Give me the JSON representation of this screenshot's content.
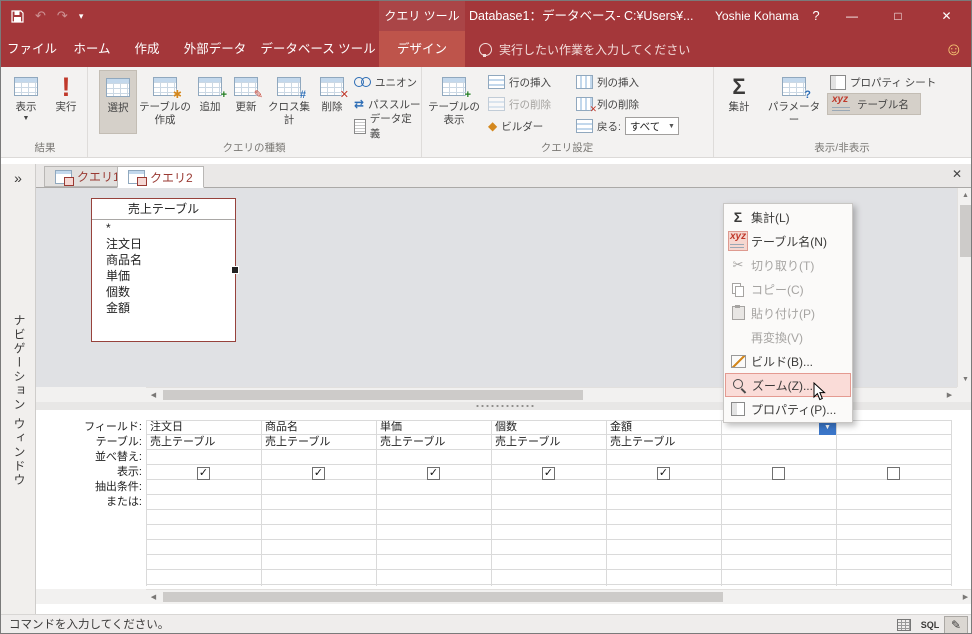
{
  "window": {
    "contextual_tool": "クエリ ツール",
    "title": "Database1：データベース- C:¥Users¥...",
    "user_name": "Yoshie Kohama",
    "help": "?"
  },
  "ribbon_tabs": {
    "file": "ファイル",
    "home": "ホーム",
    "create": "作成",
    "external_data": "外部データ",
    "db_tools": "データベース ツール",
    "design": "デザイン"
  },
  "tellme": {
    "placeholder": "実行したい作業を入力してください"
  },
  "ribbon": {
    "results": {
      "label": "結果",
      "view": "表示",
      "run": "実行"
    },
    "query_type": {
      "label": "クエリの種類",
      "select": "選択",
      "make_table": "テーブルの作成",
      "append": "追加",
      "update": "更新",
      "crosstab": "クロス集計",
      "delete": "削除",
      "union": "ユニオン",
      "pass_through": "パススルー",
      "data_definition": "データ定義"
    },
    "query_setup": {
      "label": "クエリ設定",
      "show_table": "テーブルの表示",
      "insert_rows": "行の挿入",
      "delete_rows": "行の削除",
      "builder": "ビルダー",
      "insert_columns": "列の挿入",
      "delete_columns": "列の削除",
      "return_label": "戻る:",
      "return_value": "すべて"
    },
    "show_hide": {
      "label": "表示/非表示",
      "totals": "集計",
      "parameters": "パラメーター",
      "property_sheet": "プロパティ シート",
      "table_names": "テーブル名"
    }
  },
  "nav_pane": {
    "title": "ナビゲーション ウィンドウ"
  },
  "doc_tabs": {
    "query1": "クエリ1",
    "query2": "クエリ2"
  },
  "field_list": {
    "title": "売上テーブル",
    "fields": [
      "*",
      "注文日",
      "商品名",
      "単価",
      "個数",
      "金額"
    ]
  },
  "context_menu": {
    "totals": "集計(L)",
    "table_names": "テーブル名(N)",
    "cut": "切り取り(T)",
    "copy": "コピー(C)",
    "paste": "貼り付け(P)",
    "reconvert": "再変換(V)",
    "build": "ビルド(B)...",
    "zoom": "ズーム(Z)...",
    "properties": "プロパティ(P)..."
  },
  "grid": {
    "row_labels": [
      "フィールド:",
      "テーブル:",
      "並べ替え:",
      "表示:",
      "抽出条件:",
      "または:"
    ],
    "columns": [
      {
        "field": "注文日",
        "table": "売上テーブル",
        "show": true
      },
      {
        "field": "商品名",
        "table": "売上テーブル",
        "show": true
      },
      {
        "field": "単価",
        "table": "売上テーブル",
        "show": true
      },
      {
        "field": "個数",
        "table": "売上テーブル",
        "show": true
      },
      {
        "field": "金額",
        "table": "売上テーブル",
        "show": true
      },
      {
        "field": "",
        "table": "",
        "show": false
      },
      {
        "field": "",
        "table": "",
        "show": false
      }
    ]
  },
  "status_bar": {
    "message": "コマンドを入力してください。",
    "sql_label": "SQL"
  },
  "colors": {
    "titlebar": "#A4373A",
    "active_tab": "#BE544B",
    "ribbon_bg": "#F3F2F1",
    "design_bg": "#E0E1E4",
    "menu_highlight": "#FADCD8",
    "menu_highlight_border": "#E49A91",
    "dropdown_blue": "#3B76C9"
  }
}
